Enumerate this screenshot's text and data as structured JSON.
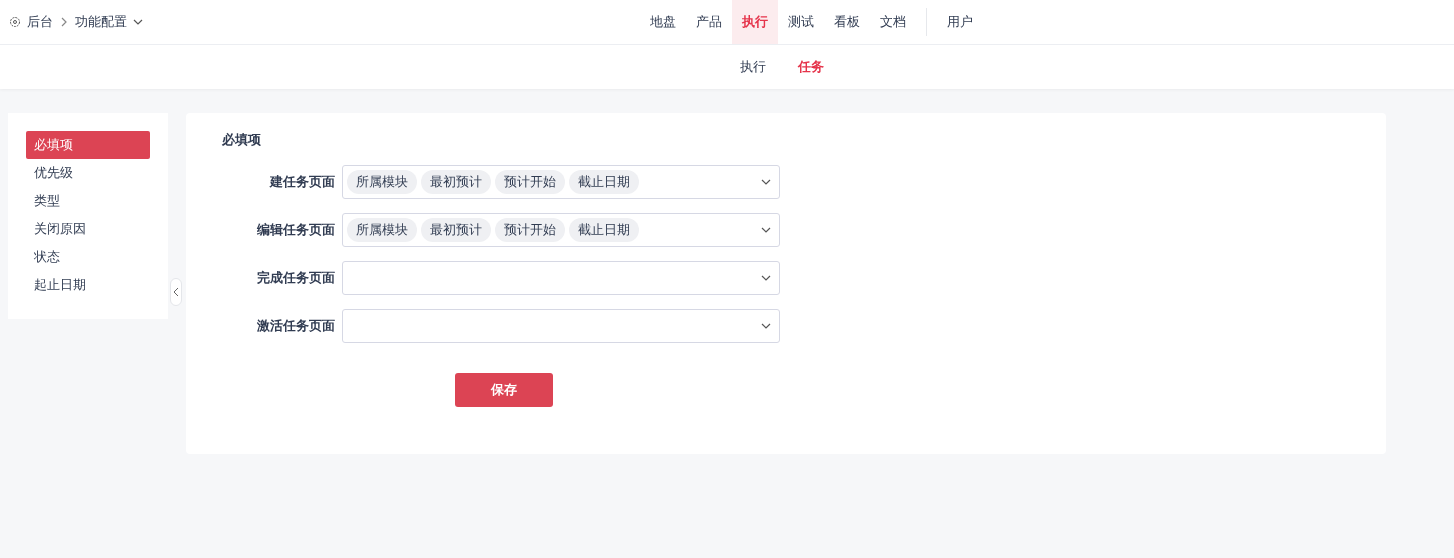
{
  "breadcrumb": {
    "home": "后台",
    "current": "功能配置"
  },
  "nav": [
    {
      "label": "地盘",
      "selected": false
    },
    {
      "label": "产品",
      "selected": false
    },
    {
      "label": "执行",
      "selected": true
    },
    {
      "label": "测试",
      "selected": false
    },
    {
      "label": "看板",
      "selected": false
    },
    {
      "label": "文档",
      "selected": false
    }
  ],
  "nav_extra": [
    {
      "label": "用户",
      "selected": false
    }
  ],
  "subnav": [
    {
      "label": "执行",
      "selected": false
    },
    {
      "label": "任务",
      "selected": true
    }
  ],
  "sidebar": {
    "items": [
      {
        "label": "必填项",
        "selected": true
      },
      {
        "label": "优先级",
        "selected": false
      },
      {
        "label": "类型",
        "selected": false
      },
      {
        "label": "关闭原因",
        "selected": false
      },
      {
        "label": "状态",
        "selected": false
      },
      {
        "label": "起止日期",
        "selected": false
      }
    ]
  },
  "form": {
    "title": "必填项",
    "fields": [
      {
        "label": "建任务页面",
        "tags": [
          "所属模块",
          "最初预计",
          "预计开始",
          "截止日期"
        ]
      },
      {
        "label": "编辑任务页面",
        "tags": [
          "所属模块",
          "最初预计",
          "预计开始",
          "截止日期"
        ]
      },
      {
        "label": "完成任务页面"
      },
      {
        "label": "激活任务页面"
      }
    ],
    "save": "保存"
  }
}
